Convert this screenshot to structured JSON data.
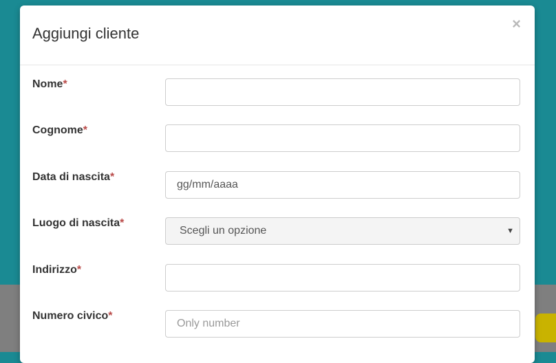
{
  "modal": {
    "title": "Aggiungi cliente",
    "close_label": "×",
    "required_mark": "*",
    "fields": [
      {
        "label": "Nome",
        "value": "",
        "placeholder": ""
      },
      {
        "label": "Cognome",
        "value": "",
        "placeholder": ""
      },
      {
        "label": "Data di nascita",
        "value": "gg/mm/aaaa",
        "placeholder": ""
      },
      {
        "label": "Luogo di nascita",
        "selected": "Scegli un opzione"
      },
      {
        "label": "Indirizzo",
        "value": "",
        "placeholder": ""
      },
      {
        "label": "Numero civico",
        "value": "",
        "placeholder": "Only number"
      }
    ]
  },
  "icons": {
    "close": "close-icon",
    "select_caret": "chevron-down-icon"
  },
  "colors": {
    "backdrop": "#1a8a93",
    "required": "#b94a48"
  }
}
